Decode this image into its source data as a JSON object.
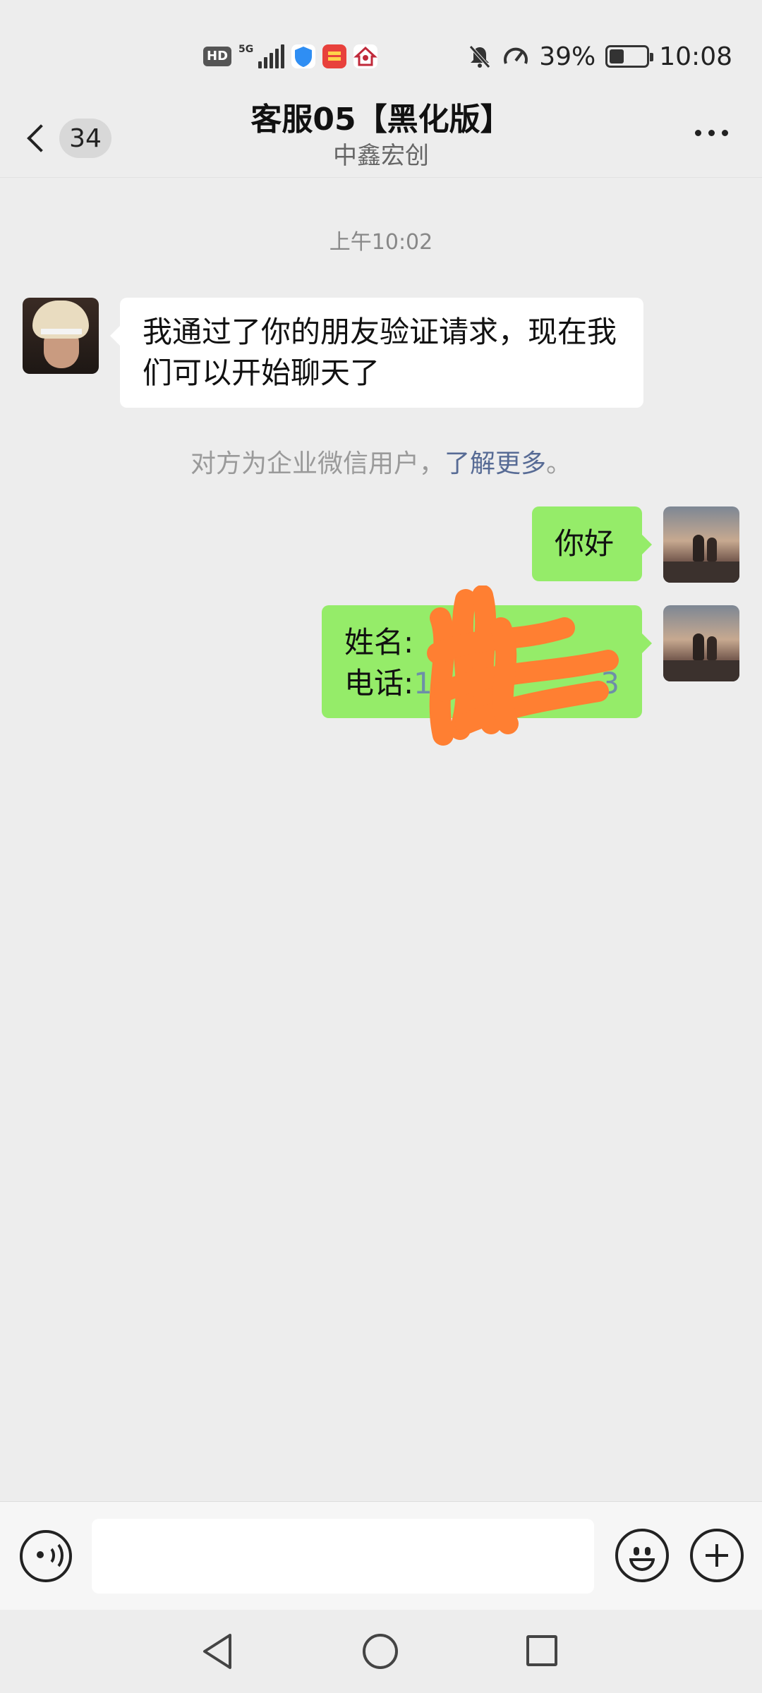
{
  "status_bar": {
    "hd": "HD",
    "network": "5G",
    "battery_percent": "39%",
    "battery_level": 0.39,
    "time": "10:08",
    "icons": [
      "hd-icon",
      "signal-icon",
      "shield-app-icon",
      "red-app-icon",
      "home-app-icon",
      "mute-bell-icon",
      "speed-icon",
      "battery-icon"
    ]
  },
  "header": {
    "back_badge": "34",
    "title": "客服05【黑化版】",
    "subtitle": "中鑫宏创"
  },
  "chat": {
    "timestamp": "上午10:02",
    "messages": [
      {
        "from": "them",
        "text": "我通过了你的朋友验证请求，现在我们可以开始聊天了"
      },
      {
        "from": "me",
        "text": "你好"
      },
      {
        "from": "me",
        "name_label": "姓名:",
        "phone_label": "电话:",
        "phone_lead": "1",
        "phone_tail": "3"
      }
    ],
    "notice": {
      "text": "对方为企业微信用户，",
      "link": "了解更多",
      "end": "。"
    }
  },
  "input_bar": {
    "placeholder": ""
  },
  "colors": {
    "background": "#ededed",
    "my_bubble": "#95ec69",
    "their_bubble": "#ffffff",
    "link": "#576b95",
    "redaction": "#ff7f32"
  }
}
